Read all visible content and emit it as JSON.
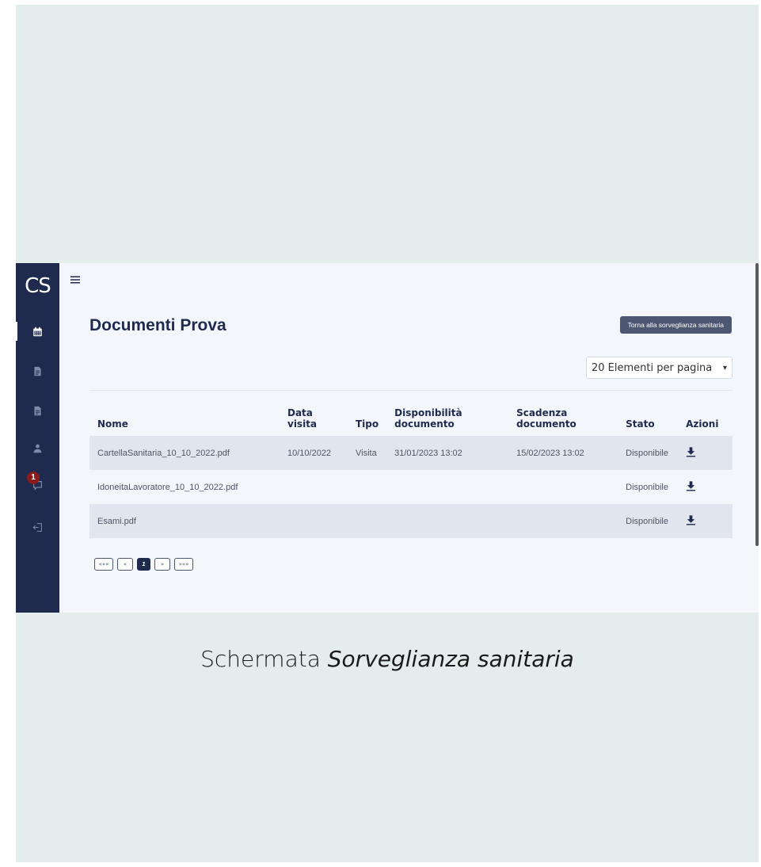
{
  "app": {
    "logo": "CS"
  },
  "sidebar": {
    "notification_count": "1"
  },
  "page": {
    "title": "Documenti Prova",
    "back_button": "Torna alla sorveglianza sanitaria"
  },
  "per_page": {
    "label": "20 Elementi per pagina"
  },
  "table": {
    "headers": {
      "nome": "Nome",
      "data_visita": "Data visita",
      "tipo": "Tipo",
      "disponibilita_1": "Disponibilità",
      "disponibilita_2": "documento",
      "scadenza_1": "Scadenza",
      "scadenza_2": "documento",
      "stato": "Stato",
      "azioni": "Azioni"
    },
    "rows": [
      {
        "nome": "CartellaSanitaria_10_10_2022.pdf",
        "data_visita": "10/10/2022",
        "tipo": "Visita",
        "disponibilita": "31/01/2023 13:02",
        "scadenza": "15/02/2023 13:02",
        "stato": "Disponibile"
      },
      {
        "nome": "IdoneitaLavoratore_10_10_2022.pdf",
        "data_visita": "",
        "tipo": "",
        "disponibilita": "",
        "scadenza": "",
        "stato": "Disponibile"
      },
      {
        "nome": "Esami.pdf",
        "data_visita": "",
        "tipo": "",
        "disponibilita": "",
        "scadenza": "",
        "stato": "Disponibile"
      }
    ]
  },
  "pagination": {
    "first": "«««",
    "prev": "«",
    "current": "1",
    "next": "»",
    "last": "»»»"
  },
  "caption": {
    "prefix": "Schermata ",
    "emphasis": "Sorveglianza sanitaria"
  }
}
